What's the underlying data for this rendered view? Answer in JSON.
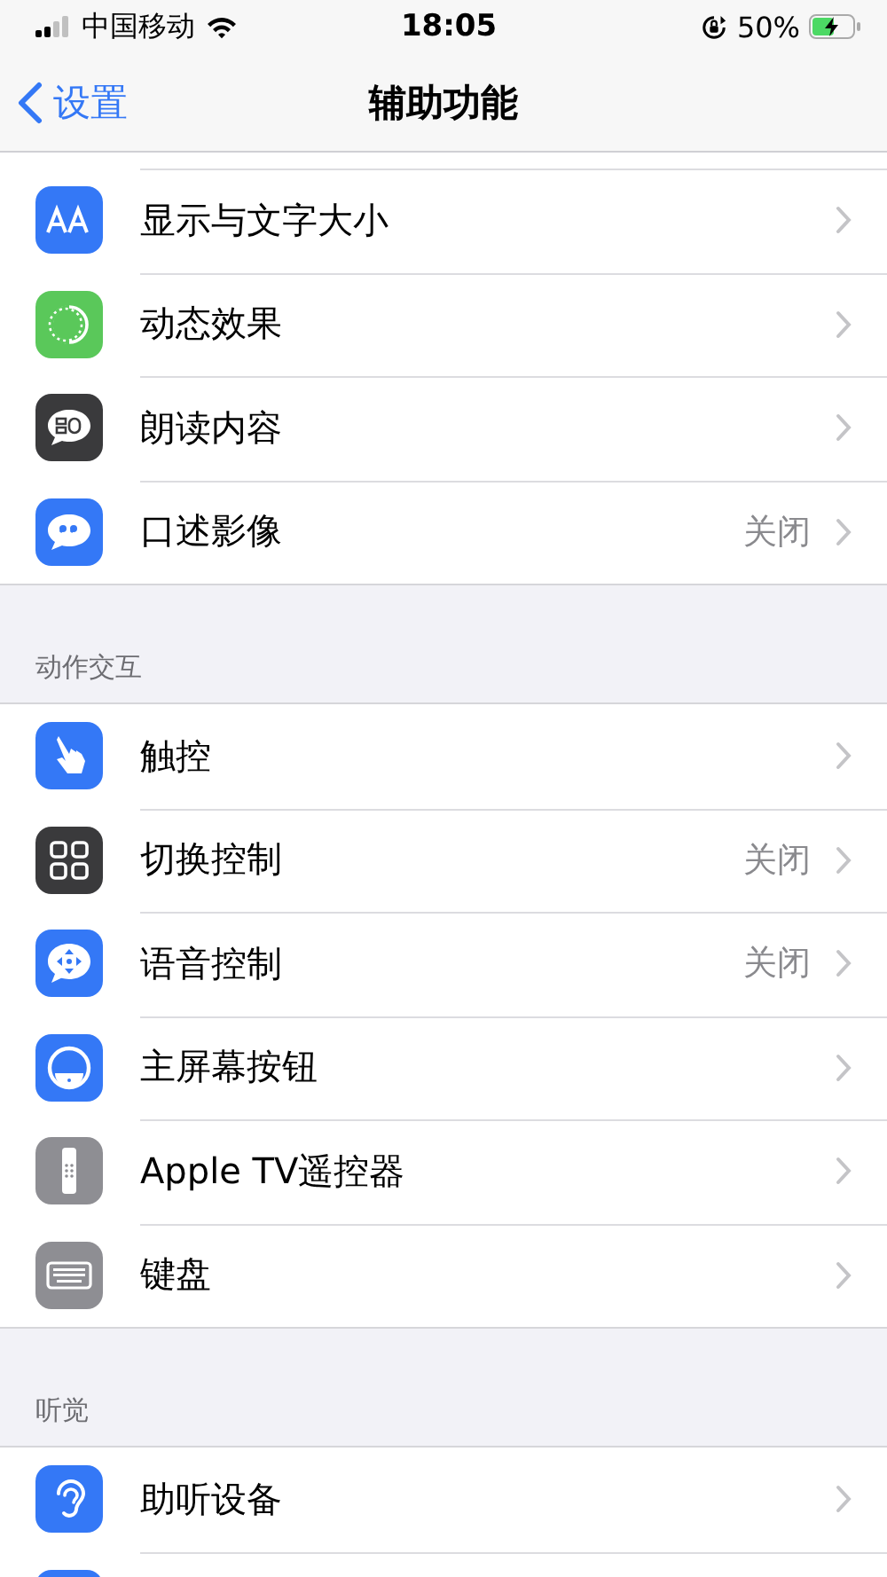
{
  "status_bar": {
    "carrier": "中国移动",
    "time": "18:05",
    "battery": "50%"
  },
  "nav": {
    "back": "设置",
    "title": "辅助功能"
  },
  "groups": [
    {
      "items": [
        {
          "kind": "text-size",
          "label": "显示与文字大小"
        },
        {
          "kind": "motion",
          "label": "动态效果"
        },
        {
          "kind": "spoken",
          "label": "朗读内容"
        },
        {
          "kind": "audio-desc",
          "label": "口述影像",
          "value": "关闭"
        }
      ]
    },
    {
      "header": "动作交互",
      "items": [
        {
          "kind": "touch",
          "label": "触控"
        },
        {
          "kind": "switch",
          "label": "切换控制",
          "value": "关闭"
        },
        {
          "kind": "voice",
          "label": "语音控制",
          "value": "关闭"
        },
        {
          "kind": "home-button",
          "label": "主屏幕按钮"
        },
        {
          "kind": "remote",
          "label": "Apple TV遥控器"
        },
        {
          "kind": "keyboard",
          "label": "键盘"
        }
      ]
    },
    {
      "header": "听觉",
      "items": [
        {
          "kind": "ear",
          "label": "助听设备"
        },
        {
          "kind": "partial"
        }
      ]
    }
  ]
}
